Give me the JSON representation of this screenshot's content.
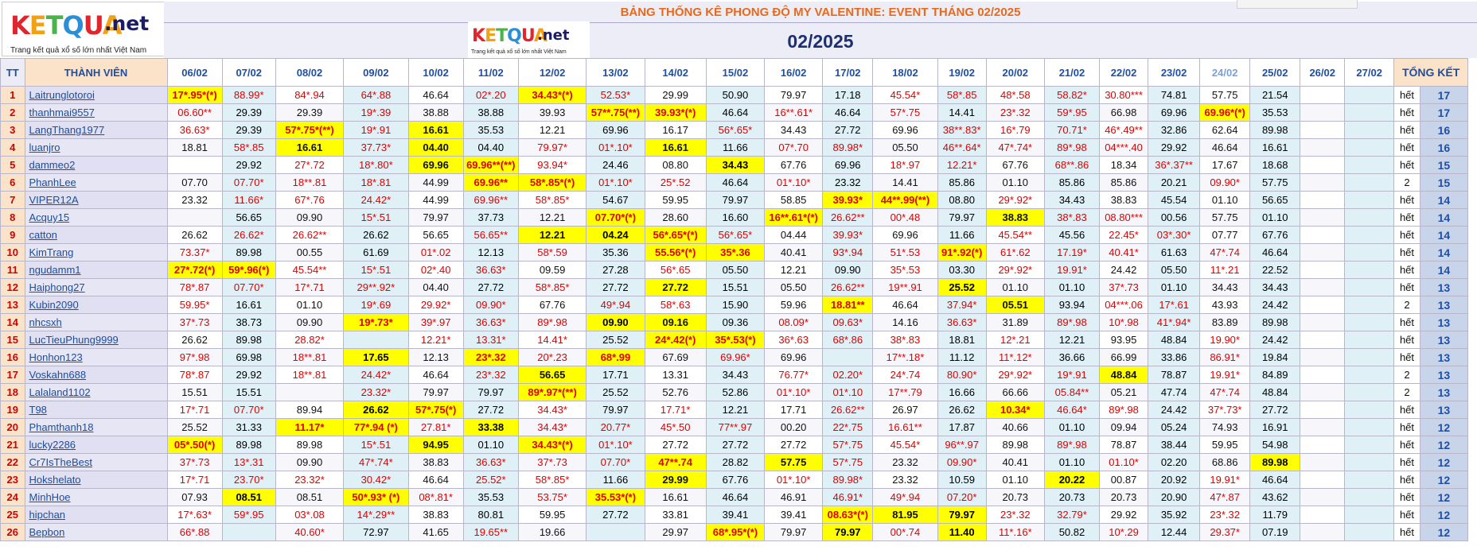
{
  "logo": {
    "text": "KETQUA",
    "suffix": ".net",
    "tagline": "Trang kết quả xổ số lớn nhất Việt Nam"
  },
  "title": "BẢNG THỐNG KÊ PHONG ĐỘ MY VALENTINE: EVENT THÁNG 02/2025",
  "month": "02/2025",
  "headers": {
    "tt": "TT",
    "member": "THÀNH VIÊN",
    "total": "TỔNG KẾT"
  },
  "dates": [
    "06/02",
    "07/02",
    "08/02",
    "09/02",
    "10/02",
    "11/02",
    "12/02",
    "13/02",
    "14/02",
    "15/02",
    "16/02",
    "17/02",
    "18/02",
    "19/02",
    "20/02",
    "21/02",
    "22/02",
    "23/02",
    "24/02",
    "25/02",
    "26/02",
    "27/02"
  ],
  "rows": [
    {
      "tt": "1",
      "name": "Laitrunglotoroi",
      "vals": [
        "17*.95*(*)",
        "88.99*",
        "84*.94",
        "64*.88",
        "46.64",
        "02*.20",
        "34.43*(*)",
        "52.53*",
        "29.99",
        "50.90",
        "79.97",
        "17.18",
        "45.54*",
        "58*.85",
        "48*.58",
        "58.82*",
        "30.80***",
        "74.81",
        "57.75",
        "21.54",
        "",
        ""
      ],
      "status": "hết",
      "total": "17"
    },
    {
      "tt": "2",
      "name": "thanhmai9557",
      "vals": [
        "06.60**",
        "29.39",
        "29.39",
        "19*.39",
        "38.88",
        "38.88",
        "39.93",
        "57**.75(**)",
        "39.93*(*)",
        "46.64",
        "16**.61*",
        "46.64",
        "57*.75",
        "14.41",
        "23*.32",
        "59*.95",
        "66.98",
        "69.96",
        "69.96*(*)",
        "35.53",
        "",
        ""
      ],
      "status": "hết",
      "total": "17"
    },
    {
      "tt": "3",
      "name": "LangThang1977",
      "vals": [
        "36.63*",
        "29.39",
        "57*.75*(**)",
        "19*.91",
        "16.61",
        "35.53",
        "12.21",
        "69.96",
        "16.17",
        "56*.65*",
        "34.43",
        "27.72",
        "69.96",
        "38**.83*",
        "16*.79",
        "70.71*",
        "46*.49**",
        "32.86",
        "62.64",
        "89.98",
        "",
        ""
      ],
      "status": "hết",
      "total": "16"
    },
    {
      "tt": "4",
      "name": "luanjro",
      "vals": [
        "18.81",
        "58*.85",
        "16.61",
        "37.73*",
        "04.40",
        "04.40",
        "79.97*",
        "01*.10*",
        "16.61",
        "11.66",
        "07*.70",
        "89.98*",
        "05.50",
        "46**.64*",
        "47*.74*",
        "89*.98",
        "04***.40",
        "29.92",
        "46.64",
        "16.61",
        "",
        ""
      ],
      "status": "hết",
      "total": "16"
    },
    {
      "tt": "5",
      "name": "dammeo2",
      "vals": [
        "",
        "29.92",
        "27*.72",
        "18*.80*",
        "69.96",
        "69.96**(**)",
        "93.94*",
        "24.46",
        "08.80",
        "34.43",
        "67.76",
        "69.96",
        "18*.97",
        "12.21*",
        "67.76",
        "68**.86",
        "18.34",
        "36*.37**",
        "17.67",
        "18.68",
        "",
        ""
      ],
      "status": "hết",
      "total": "15"
    },
    {
      "tt": "6",
      "name": "PhanhLee",
      "vals": [
        "07.70",
        "07.70*",
        "18**.81",
        "18*.81",
        "44.99",
        "69.96**",
        "58*.85*(*)",
        "01*.10*",
        "25*.52",
        "46.64",
        "01*.10*",
        "23.32",
        "14.41",
        "85.86",
        "01.10",
        "85.86",
        "85.86",
        "20.21",
        "09.90*",
        "57.75",
        "",
        ""
      ],
      "status": "2",
      "total": "15"
    },
    {
      "tt": "7",
      "name": "VIPER12A",
      "vals": [
        "23.32",
        "11.66*",
        "67*.76",
        "24.42*",
        "44.99",
        "69.96**",
        "58*.85*",
        "54.67",
        "59.95",
        "79.97",
        "58.85",
        "39.93*",
        "44**.99(**)",
        "08.80",
        "29*.92*",
        "34.43",
        "38.83",
        "45.54",
        "01.10",
        "56.65",
        "",
        ""
      ],
      "status": "hết",
      "total": "14"
    },
    {
      "tt": "8",
      "name": "Acquy15",
      "vals": [
        "",
        "56.65",
        "09.90",
        "15*.51",
        "79.97",
        "37.73",
        "12.21",
        "07.70*(*)",
        "28.60",
        "16.60",
        "16**.61*(*)",
        "26.62**",
        "00*.48",
        "79.97",
        "38.83",
        "38*.83",
        "08.80***",
        "00.56",
        "57.75",
        "01.10",
        "",
        ""
      ],
      "status": "hết",
      "total": "14"
    },
    {
      "tt": "9",
      "name": "catton",
      "vals": [
        "26.62",
        "26.62*",
        "26.62**",
        "26.62",
        "56.65",
        "56.65**",
        "12.21",
        "04.24",
        "56*.65*(*)",
        "56*.65*",
        "04.44",
        "39.93*",
        "69.96",
        "11.66",
        "45.54**",
        "45.56",
        "22.45*",
        "03*.30*",
        "07.77",
        "67.76",
        "",
        ""
      ],
      "status": "hết",
      "total": "14"
    },
    {
      "tt": "10",
      "name": "KimTrang",
      "vals": [
        "73.37*",
        "89.98",
        "00.55",
        "61.69",
        "01*.02",
        "12.13",
        "58*.59",
        "35.36",
        "55.56*(*)",
        "35*.36",
        "40.41",
        "93*.94",
        "51*.53",
        "91*.92(*)",
        "61*.62",
        "17.19*",
        "40.41*",
        "61.63",
        "47*.74",
        "46.64",
        "",
        ""
      ],
      "status": "hết",
      "total": "14"
    },
    {
      "tt": "11",
      "name": "ngudamm1",
      "vals": [
        "27*.72(*)",
        "59*.96(*)",
        "45.54**",
        "15*.51",
        "02*.40",
        "36.63*",
        "09.59",
        "27.28",
        "56*.65",
        "05.50",
        "12.21",
        "09.90",
        "35*.53",
        "03.30",
        "29*.92*",
        "19.91*",
        "24.42",
        "05.50",
        "11*.21",
        "22.52",
        "",
        ""
      ],
      "status": "hết",
      "total": "14"
    },
    {
      "tt": "12",
      "name": "Haiphong27",
      "vals": [
        "78*.87",
        "07.70*",
        "17*.71",
        "29**.92*",
        "04.40",
        "27.72",
        "58*.85*",
        "27.72",
        "27.72",
        "15.51",
        "05.50",
        "26.62**",
        "19**.91",
        "25.52",
        "01.10",
        "01.10",
        "37*.73",
        "01.10",
        "34.43",
        "34.43",
        "",
        ""
      ],
      "status": "hết",
      "total": "13"
    },
    {
      "tt": "13",
      "name": "Kubin2090",
      "vals": [
        "59.95*",
        "16.61",
        "01.10",
        "19*.69",
        "29.92*",
        "09.90*",
        "67.76",
        "49*.94",
        "58*.63",
        "15.90",
        "59.96",
        "18.81**",
        "46.64",
        "37.94*",
        "05.51",
        "93.94",
        "04***.06",
        "17*.61",
        "43.93",
        "24.42",
        "",
        ""
      ],
      "status": "2",
      "total": "13"
    },
    {
      "tt": "14",
      "name": "nhcsxh",
      "vals": [
        "37*.73",
        "38.73",
        "09.90",
        "19*.73*",
        "39*.97",
        "36.63*",
        "89*.98",
        "09.90",
        "09.16",
        "09.36",
        "08.09*",
        "09.63*",
        "14.16",
        "36.63*",
        "31.89",
        "89*.98",
        "10*.98",
        "41*.94*",
        "83.89",
        "89.98",
        "",
        ""
      ],
      "status": "hết",
      "total": "13"
    },
    {
      "tt": "15",
      "name": "LucTieuPhung9999",
      "vals": [
        "26.62",
        "89.98",
        "28.82*",
        "",
        "12.21*",
        "13.31*",
        "14.41*",
        "25.52",
        "24*.42(*)",
        "35*.53(*)",
        "36*.63",
        "68*.86",
        "38*.83",
        "18.81",
        "12*.21",
        "12.21",
        "93.95",
        "48.84",
        "19.90*",
        "24.42",
        "",
        ""
      ],
      "status": "hết",
      "total": "13"
    },
    {
      "tt": "16",
      "name": "Honhon123",
      "vals": [
        "97*.98",
        "69.98",
        "18**.81",
        "17.65",
        "12.13",
        "23*.32",
        "20*.23",
        "68*.99",
        "67.69",
        "69.96*",
        "69.96",
        "",
        "17**.18*",
        "11.12",
        "11*.12*",
        "36.66",
        "66.99",
        "33.86",
        "86.91*",
        "19.84",
        "",
        ""
      ],
      "status": "hết",
      "total": "13"
    },
    {
      "tt": "17",
      "name": "Voskahn688",
      "vals": [
        "78*.87",
        "29.92",
        "18**.81",
        "24.42*",
        "46.64",
        "23*.32",
        "56.65",
        "17.71",
        "13.31",
        "34.43",
        "76.77*",
        "02.20*",
        "24*.74",
        "80.90*",
        "29*.92*",
        "19*.91",
        "48.84",
        "78.87",
        "19.91*",
        "84.89",
        "",
        ""
      ],
      "status": "2",
      "total": "13"
    },
    {
      "tt": "18",
      "name": "Lalaland1102",
      "vals": [
        "15.51",
        "15.51",
        "",
        "23.32*",
        "79.97",
        "79.97",
        "89*.97*(**)",
        "25.52",
        "52.76",
        "52.86",
        "01*.10*",
        "01*.10",
        "17**.79",
        "16.66",
        "66.66",
        "05.84**",
        "05.21",
        "47.74",
        "47*.74",
        "48.84",
        "",
        ""
      ],
      "status": "2",
      "total": "13"
    },
    {
      "tt": "19",
      "name": "T98",
      "vals": [
        "17*.71",
        "07.70*",
        "89.94",
        "26.62",
        "57*.75(*)",
        "27.72",
        "34.43*",
        "79.97",
        "17.71*",
        "12.21",
        "17.71",
        "26.62**",
        "26.97",
        "26.62",
        "10.34*",
        "46.64*",
        "89*.98",
        "24.42",
        "37*.73*",
        "27.72",
        "",
        ""
      ],
      "status": "hết",
      "total": "13"
    },
    {
      "tt": "20",
      "name": "Phamthanh18",
      "vals": [
        "25.52",
        "31.33",
        "11.17*",
        "77*.94 (*)",
        "27.81*",
        "33.38",
        "34.43*",
        "20.77*",
        "45*.50",
        "77**.97",
        "00.20",
        "22*.75",
        "16.61**",
        "17.87",
        "40.66",
        "01.10",
        "09.94",
        "05.24",
        "74.93",
        "16.91",
        "",
        ""
      ],
      "status": "hết",
      "total": "12"
    },
    {
      "tt": "21",
      "name": "lucky2286",
      "vals": [
        "05*.50(*)",
        "89.98",
        "89.98",
        "15*.51",
        "94.95",
        "01.10",
        "34.43*(*)",
        "01*.10*",
        "27.72",
        "27.72",
        "27.72",
        "57*.75",
        "45.54*",
        "96**.97",
        "89.98",
        "89*.98",
        "78.87",
        "38.44",
        "59.95",
        "54.98",
        "",
        ""
      ],
      "status": "hết",
      "total": "12"
    },
    {
      "tt": "22",
      "name": "Cr7IsTheBest",
      "vals": [
        "37*.73",
        "13*.31",
        "09.90",
        "47*.74*",
        "38.83",
        "36.63*",
        "37*.73",
        "07.70*",
        "47**.74",
        "28.82",
        "57.75",
        "57*.75",
        "23.32",
        "09.90*",
        "40.41",
        "01.10",
        "01.10*",
        "02.20",
        "68.86",
        "89.98",
        "",
        ""
      ],
      "status": "hết",
      "total": "12"
    },
    {
      "tt": "23",
      "name": "Hokshelato",
      "vals": [
        "17*.71",
        "23.70*",
        "23.32*",
        "30.42*",
        "46.64",
        "25.52*",
        "58*.85*",
        "11.66",
        "29.99",
        "67.76",
        "01*.10*",
        "89.98*",
        "23.32",
        "10.59",
        "01.10",
        "20.22",
        "00.87",
        "20.92",
        "19.91*",
        "46.64",
        "",
        ""
      ],
      "status": "hết",
      "total": "12"
    },
    {
      "tt": "24",
      "name": "MinhHoe",
      "vals": [
        "07.93",
        "08.51",
        "08.51",
        "50*.93* (*)",
        "08*.81*",
        "35.53",
        "53.75*",
        "35.53*(*)",
        "16.61",
        "46.64",
        "46.91",
        "46.91*",
        "49*.94",
        "07.20*",
        "20.73",
        "20.73",
        "20.73",
        "20.90",
        "47*.87",
        "43.62",
        "",
        ""
      ],
      "status": "hết",
      "total": "12"
    },
    {
      "tt": "25",
      "name": "hipchan",
      "vals": [
        "17*.63*",
        "59*.95",
        "03*.08",
        "14*.29**",
        "38.83",
        "80.81",
        "59.95",
        "27.72",
        "33.81",
        "39.41",
        "39.41",
        "08.63*(*)",
        "81.95",
        "79.97",
        "23*.32",
        "32.79*",
        "29.92",
        "35.92",
        "23*.32",
        "11.79",
        "",
        ""
      ],
      "status": "hết",
      "total": "12"
    },
    {
      "tt": "26",
      "name": "Bepbon",
      "vals": [
        "66*.88",
        "",
        "40.60*",
        "72.97",
        "41.65",
        "19.65**",
        "19.66",
        "",
        "29.97",
        "68*.95*(*)",
        "79.97",
        "79.97",
        "00*.74",
        "11.40",
        "11*.16*",
        "50.82",
        "10*.29",
        "12.44",
        "29.37*",
        "07.19",
        "",
        ""
      ],
      "status": "hết",
      "total": "12"
    }
  ],
  "highlights": [
    [
      0,
      0
    ],
    [
      0,
      6
    ],
    [
      1,
      7
    ],
    [
      1,
      8
    ],
    [
      1,
      18
    ],
    [
      2,
      2
    ],
    [
      2,
      4
    ],
    [
      3,
      2
    ],
    [
      3,
      4
    ],
    [
      3,
      8
    ],
    [
      4,
      4
    ],
    [
      4,
      5
    ],
    [
      4,
      9
    ],
    [
      5,
      5
    ],
    [
      5,
      6
    ],
    [
      6,
      11
    ],
    [
      6,
      12
    ],
    [
      7,
      7
    ],
    [
      7,
      10
    ],
    [
      7,
      14
    ],
    [
      8,
      6
    ],
    [
      8,
      7
    ],
    [
      8,
      8
    ],
    [
      9,
      8
    ],
    [
      9,
      9
    ],
    [
      9,
      13
    ],
    [
      10,
      0
    ],
    [
      10,
      1
    ],
    [
      11,
      8
    ],
    [
      11,
      13
    ],
    [
      12,
      11
    ],
    [
      12,
      14
    ],
    [
      13,
      3
    ],
    [
      13,
      7
    ],
    [
      13,
      8
    ],
    [
      14,
      8
    ],
    [
      14,
      9
    ],
    [
      15,
      3
    ],
    [
      15,
      5
    ],
    [
      15,
      7
    ],
    [
      16,
      6
    ],
    [
      16,
      16
    ],
    [
      17,
      6
    ],
    [
      18,
      3
    ],
    [
      18,
      4
    ],
    [
      18,
      14
    ],
    [
      19,
      2
    ],
    [
      19,
      3
    ],
    [
      19,
      5
    ],
    [
      20,
      0
    ],
    [
      20,
      4
    ],
    [
      20,
      6
    ],
    [
      21,
      8
    ],
    [
      21,
      10
    ],
    [
      21,
      19
    ],
    [
      22,
      8
    ],
    [
      22,
      15
    ],
    [
      23,
      1
    ],
    [
      23,
      3
    ],
    [
      23,
      7
    ],
    [
      24,
      11
    ],
    [
      24,
      12
    ],
    [
      24,
      13
    ],
    [
      25,
      9
    ],
    [
      25,
      11
    ],
    [
      25,
      13
    ]
  ],
  "colors": {
    "red": "#e00000",
    "highlight": "#ffff00",
    "header_blue": "#1f4fa2",
    "title_orange": "#e76a1c"
  }
}
